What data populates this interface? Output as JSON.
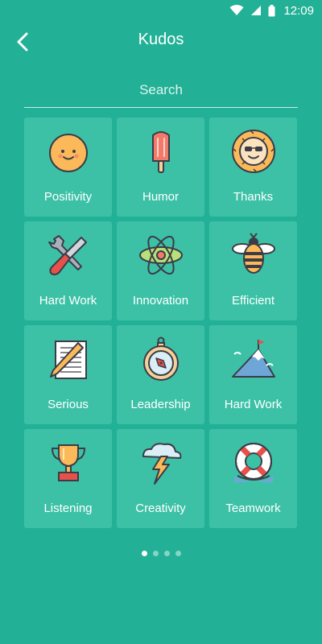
{
  "status_bar": {
    "time": "12:09"
  },
  "header": {
    "title": "Kudos",
    "back_icon": "chevron-left-icon"
  },
  "search": {
    "placeholder": "Search"
  },
  "kudos": [
    {
      "label": "Positivity",
      "icon": "smiley-face-icon"
    },
    {
      "label": "Humor",
      "icon": "popsicle-icon"
    },
    {
      "label": "Thanks",
      "icon": "sun-face-icon"
    },
    {
      "label": "Hard Work",
      "icon": "tools-icon"
    },
    {
      "label": "Innovation",
      "icon": "atom-icon"
    },
    {
      "label": "Efficient",
      "icon": "bee-icon"
    },
    {
      "label": "Serious",
      "icon": "notepad-pencil-icon"
    },
    {
      "label": "Leadership",
      "icon": "compass-icon"
    },
    {
      "label": "Hard Work",
      "icon": "mountain-flag-icon"
    },
    {
      "label": "Listening",
      "icon": "trophy-icon"
    },
    {
      "label": "Creativity",
      "icon": "lightning-cloud-icon"
    },
    {
      "label": "Teamwork",
      "icon": "life-buoy-icon"
    }
  ],
  "pager": {
    "pages": 4,
    "current": 1
  },
  "colors": {
    "background": "#22b196",
    "tile": "#3cc1a7"
  }
}
